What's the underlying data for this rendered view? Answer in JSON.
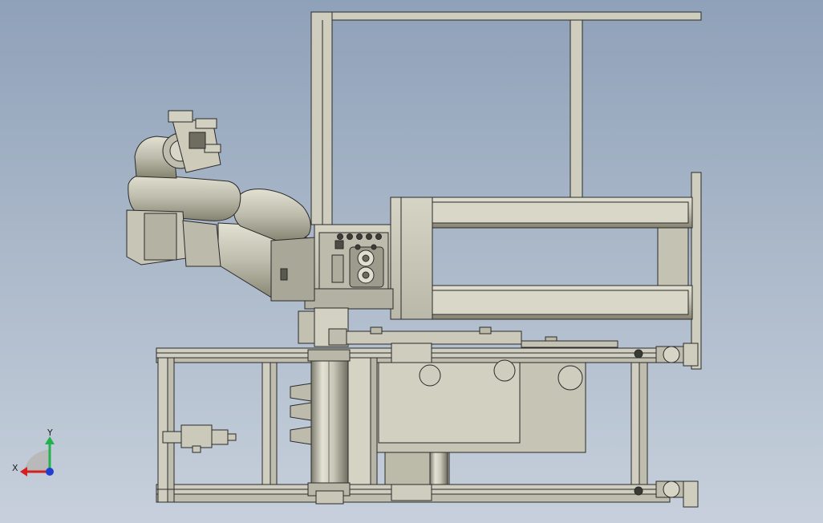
{
  "triad": {
    "x_label": "X",
    "y_label": "Y",
    "x_color": "#d42020",
    "y_color": "#22b14c",
    "z_color": "#1f3fd1"
  },
  "colors": {
    "background_top": "#8fa1b9",
    "background_bottom": "#c7d0dc",
    "part_fill": "#cfcdbe",
    "part_dark": "#8d8b7c",
    "edge": "#2a2a2a"
  }
}
